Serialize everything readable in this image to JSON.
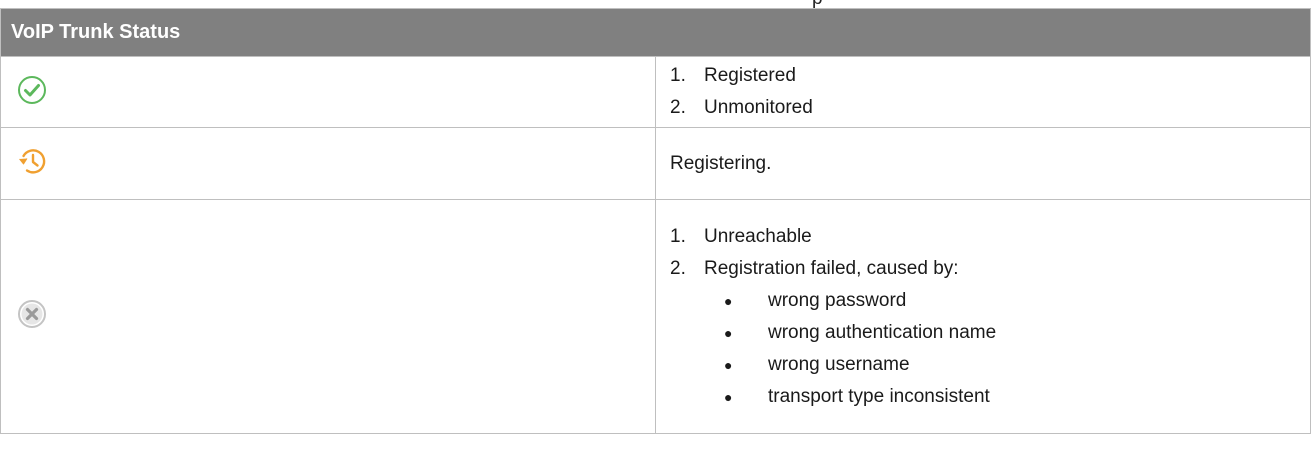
{
  "table": {
    "header": "VoIP Trunk Status",
    "rows": [
      {
        "icon": "check-circle-icon",
        "icon_color": "#5cb85c",
        "items": [
          {
            "number": "1.",
            "text": "Registered"
          },
          {
            "number": "2.",
            "text": "Unmonitored"
          }
        ]
      },
      {
        "icon": "history-clock-icon",
        "icon_color": "#f0a030",
        "text": "Registering."
      },
      {
        "icon": "x-circle-icon",
        "icon_color": "#b0b0b0",
        "items": [
          {
            "number": "1.",
            "text": "Unreachable"
          },
          {
            "number": "2.",
            "text": "Registration failed, caused by:"
          }
        ],
        "bullet_glyph": "●",
        "bullets": [
          "wrong password",
          "wrong authentication name",
          "wrong username",
          "transport type inconsistent"
        ]
      }
    ]
  }
}
